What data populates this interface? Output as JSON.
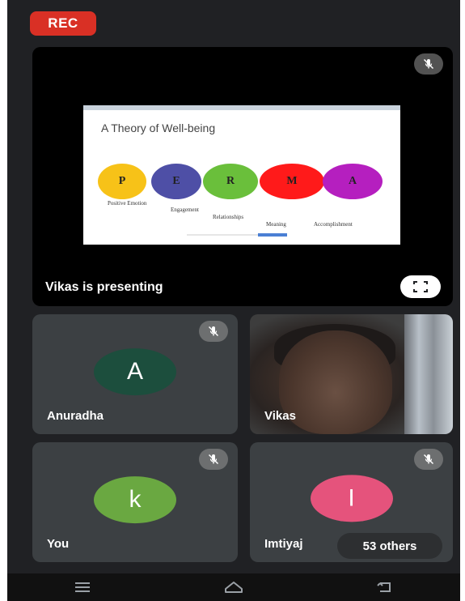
{
  "recording": {
    "label": "REC",
    "color": "#d93025"
  },
  "presentation": {
    "presenting_label": "Vikas is presenting",
    "slide": {
      "title": "A Theory of Well-being",
      "letters": [
        "P",
        "E",
        "R",
        "M",
        "A"
      ],
      "letter_colors": [
        "#f7c218",
        "#4e4fa6",
        "#6abf3b",
        "#ff1a1a",
        "#b51fbf"
      ],
      "captions": [
        "Positive Emotion",
        "Engagement",
        "Relationships",
        "Meaning",
        "Accomplishment"
      ]
    }
  },
  "participants": [
    {
      "name": "Anuradha",
      "initial": "A",
      "avatar_color": "#1c4e3d",
      "muted": true
    },
    {
      "name": "Vikas",
      "video": true,
      "muted": false
    },
    {
      "name": "You",
      "initial": "k",
      "avatar_color": "#6aa841",
      "muted": true
    },
    {
      "name": "Imtiyaj",
      "initial": "I",
      "avatar_color": "#e5537c",
      "muted": true
    }
  ],
  "others_chip": "53 others",
  "icons": {
    "mute": "mic-off-icon",
    "fullscreen": "fullscreen-icon",
    "nav": [
      "menu-icon",
      "home-icon",
      "back-icon"
    ]
  }
}
